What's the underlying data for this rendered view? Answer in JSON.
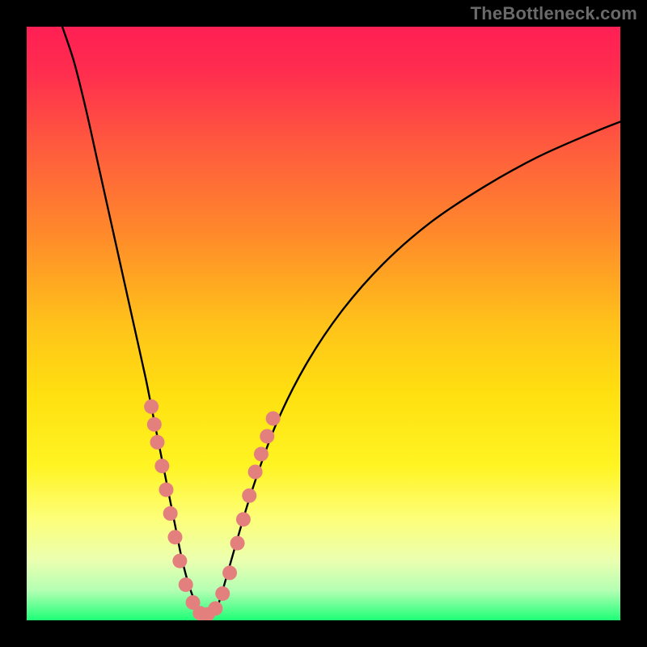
{
  "watermark": "TheBottleneck.com",
  "chart_data": {
    "type": "line",
    "title": "",
    "xlabel": "",
    "ylabel": "",
    "xlim": [
      0,
      100
    ],
    "ylim": [
      0,
      100
    ],
    "grid": false,
    "legend": false,
    "background_gradient": {
      "stops": [
        {
          "offset": 0.0,
          "color": "#ff1f54"
        },
        {
          "offset": 0.08,
          "color": "#ff2e4e"
        },
        {
          "offset": 0.2,
          "color": "#ff5a3e"
        },
        {
          "offset": 0.35,
          "color": "#ff8a2a"
        },
        {
          "offset": 0.5,
          "color": "#ffc21a"
        },
        {
          "offset": 0.62,
          "color": "#ffe010"
        },
        {
          "offset": 0.74,
          "color": "#fff423"
        },
        {
          "offset": 0.83,
          "color": "#fdff7a"
        },
        {
          "offset": 0.9,
          "color": "#eaffb0"
        },
        {
          "offset": 0.95,
          "color": "#b3ffb3"
        },
        {
          "offset": 1.0,
          "color": "#1dff76"
        }
      ]
    },
    "series": [
      {
        "name": "curve",
        "x": [
          6,
          8,
          10,
          12,
          14,
          16,
          18,
          20,
          21,
          22,
          23,
          24,
          25,
          26,
          27,
          28,
          29,
          30,
          31,
          32,
          33,
          35,
          38,
          42,
          47,
          53,
          60,
          68,
          77,
          86,
          95,
          100
        ],
        "y": [
          100,
          94,
          86,
          77,
          68,
          59,
          50,
          41,
          36,
          31,
          26,
          21,
          16,
          11,
          7,
          4,
          2,
          1,
          1,
          2,
          5,
          12,
          22,
          33,
          43,
          52,
          60,
          67,
          73,
          78,
          82,
          84
        ]
      }
    ],
    "markers": {
      "name": "dots",
      "color": "#e3807e",
      "radius_px": 9,
      "points": [
        {
          "x": 21.0,
          "y": 36
        },
        {
          "x": 21.5,
          "y": 33
        },
        {
          "x": 22.0,
          "y": 30
        },
        {
          "x": 22.8,
          "y": 26
        },
        {
          "x": 23.5,
          "y": 22
        },
        {
          "x": 24.2,
          "y": 18
        },
        {
          "x": 25.0,
          "y": 14
        },
        {
          "x": 25.8,
          "y": 10
        },
        {
          "x": 26.8,
          "y": 6
        },
        {
          "x": 28.0,
          "y": 3
        },
        {
          "x": 29.2,
          "y": 1.2
        },
        {
          "x": 30.5,
          "y": 1.0
        },
        {
          "x": 31.8,
          "y": 2.0
        },
        {
          "x": 33.0,
          "y": 4.5
        },
        {
          "x": 34.2,
          "y": 8
        },
        {
          "x": 35.5,
          "y": 13
        },
        {
          "x": 36.5,
          "y": 17
        },
        {
          "x": 37.5,
          "y": 21
        },
        {
          "x": 38.5,
          "y": 25
        },
        {
          "x": 39.5,
          "y": 28
        },
        {
          "x": 40.5,
          "y": 31
        },
        {
          "x": 41.5,
          "y": 34
        }
      ]
    },
    "frame": {
      "border_px": 33,
      "border_color": "#000000"
    }
  }
}
